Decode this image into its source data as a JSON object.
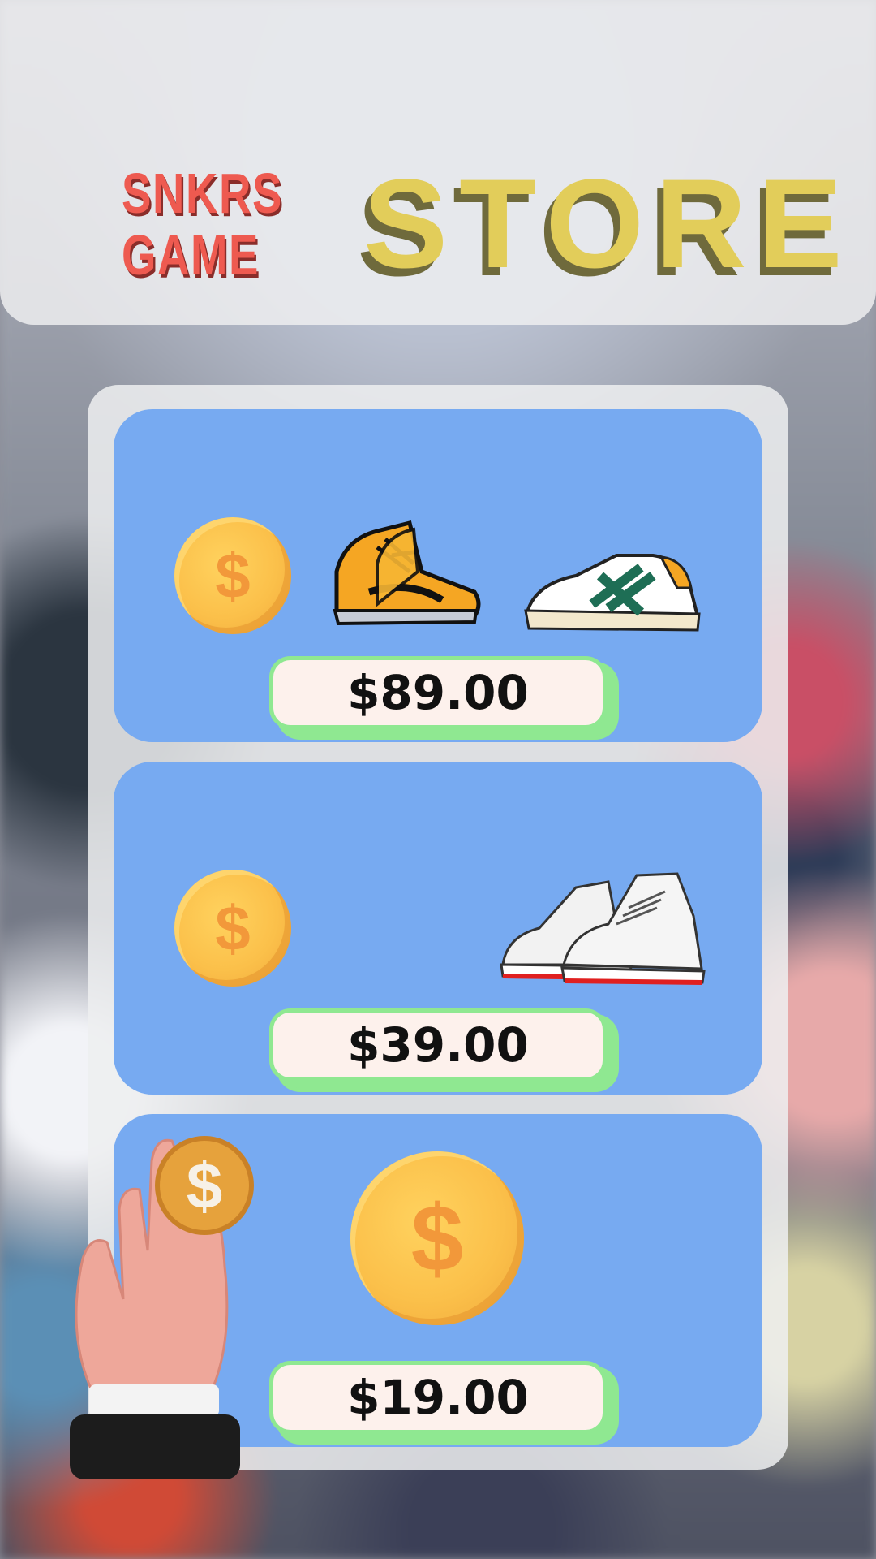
{
  "header": {
    "logo_line1": "SNKRS",
    "logo_line2": "GAME",
    "title": "STORE"
  },
  "currency_symbol": "$",
  "products": [
    {
      "price": "$89.00",
      "items": [
        "coin-icon",
        "yellow-high-top-sneaker-icon",
        "white-green-low-sneaker-icon"
      ]
    },
    {
      "price": "$39.00",
      "items": [
        "coin-icon",
        "white-high-top-sneakers-icon"
      ]
    },
    {
      "price": "$19.00",
      "items": [
        "coin-icon"
      ]
    }
  ],
  "colors": {
    "card": "#77aaf1",
    "price_border": "#8fe891",
    "title": "#e2cd5a",
    "logo": "#ee5a50",
    "coin": "#fbc04a"
  }
}
